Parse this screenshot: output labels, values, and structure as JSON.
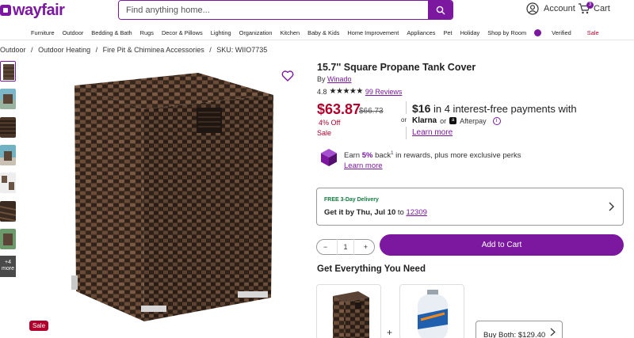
{
  "header": {
    "logo_text": "wayfair",
    "search_placeholder": "Find anything home...",
    "account_label": "Account",
    "cart_label": "Cart",
    "cart_count": "3"
  },
  "categories": [
    "Furniture",
    "Outdoor",
    "Bedding & Bath",
    "Rugs",
    "Decor & Pillows",
    "Lighting",
    "Organization",
    "Kitchen",
    "Baby & Kids",
    "Home Improvement",
    "Appliances",
    "Pet",
    "Holiday",
    "Shop by Room",
    "Verified",
    "Sale"
  ],
  "breadcrumb": [
    "Outdoor",
    "/",
    "Outdoor Heating",
    "/",
    "Fire Pit & Chiminea Accessories",
    "/",
    "SKU: WIIO7735"
  ],
  "thumbnails": {
    "more_label": "+4 more"
  },
  "product": {
    "title": "15.7'' Square Propane Tank Cover",
    "by_prefix": "By",
    "brand": "Winado",
    "rating": "4.8",
    "stars": "★★★★★",
    "reviews": "99 Reviews",
    "price": "$63.87",
    "original_price": "$66.73",
    "discount": "4% Off",
    "sale_label": "Sale",
    "or_label": "or",
    "installment_amount": "$16",
    "installment_text": "in 4 interest-free payments with",
    "klarna": "Klarna",
    "or2": "or",
    "afterpay": "Afterpay",
    "learn_more": "Learn more",
    "rewards_prefix": "Earn",
    "rewards_pct": "5%",
    "rewards_back": "back",
    "rewards_sup": "1",
    "rewards_suffix": " in rewards, plus more exclusive perks",
    "rewards_learn": "Learn more",
    "image_badge": "Sale"
  },
  "delivery": {
    "tag": "FREE 3-Day Delivery",
    "text_prefix": "Get it by Thu, Jul 10",
    "text_to": " to ",
    "zip": "12309"
  },
  "purchase": {
    "qty_minus": "−",
    "qty": "1",
    "qty_plus": "+",
    "add_to_cart": "Add to Cart"
  },
  "bundle": {
    "heading": "Get Everything You Need",
    "plus": "+",
    "buy_both": "Buy Both: $129.40"
  },
  "colors": {
    "brand": "#7b189f",
    "sale": "#b1002b",
    "delivery_green": "#137b3d"
  }
}
